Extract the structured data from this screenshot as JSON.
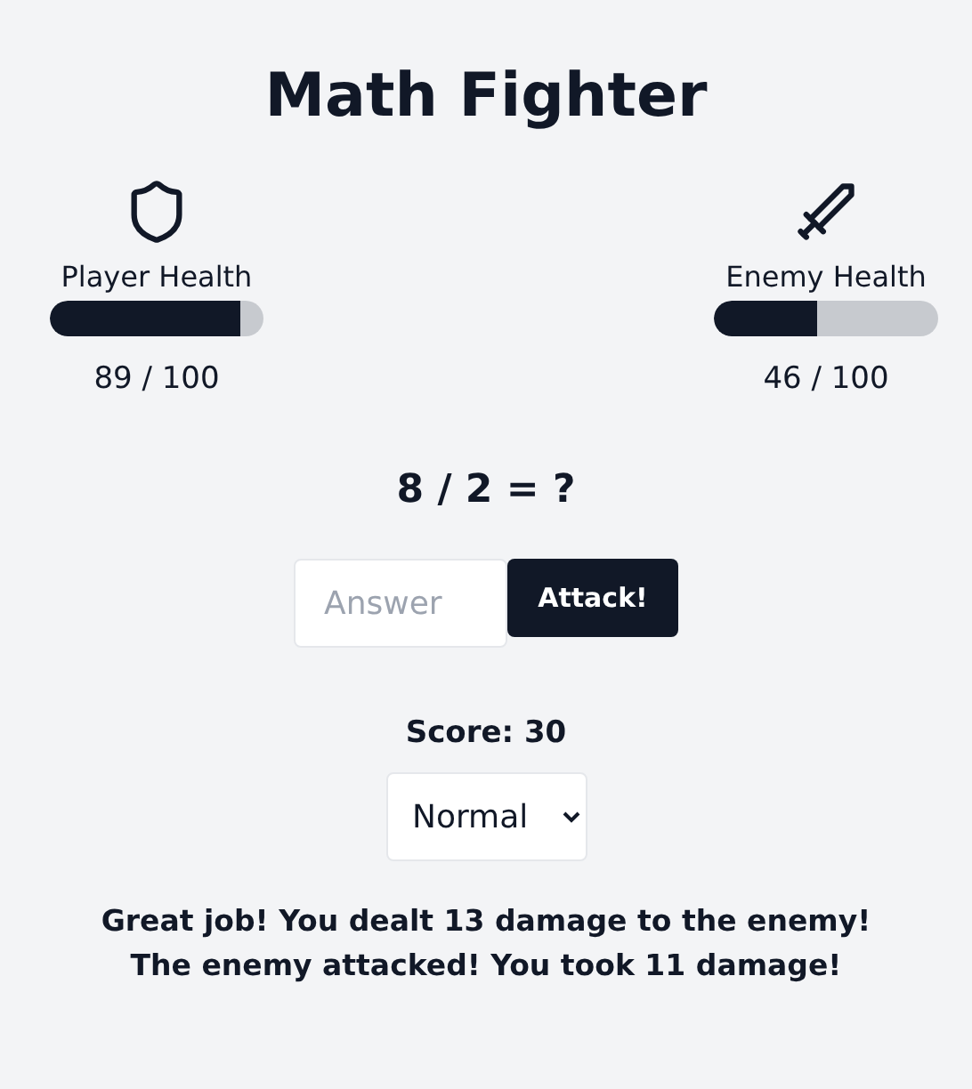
{
  "title": "Math Fighter",
  "fighters": [
    {
      "kind": "player",
      "label": "Player Health",
      "level": 0.89,
      "reading": "89 / 100"
    },
    {
      "kind": "enemy",
      "label": "Enemy Health",
      "level": 0.46,
      "reading": "46 / 100"
    }
  ],
  "question": "8 / 2 = ?",
  "answer": {
    "placeholder": "Answer"
  },
  "attack_button": "Attack!",
  "score": "Score: 30",
  "difficulty": {
    "value": "Normal"
  },
  "messages": [
    "Great job! You dealt 13 damage to the enemy!",
    "The enemy attacked! You took 11 damage!"
  ]
}
